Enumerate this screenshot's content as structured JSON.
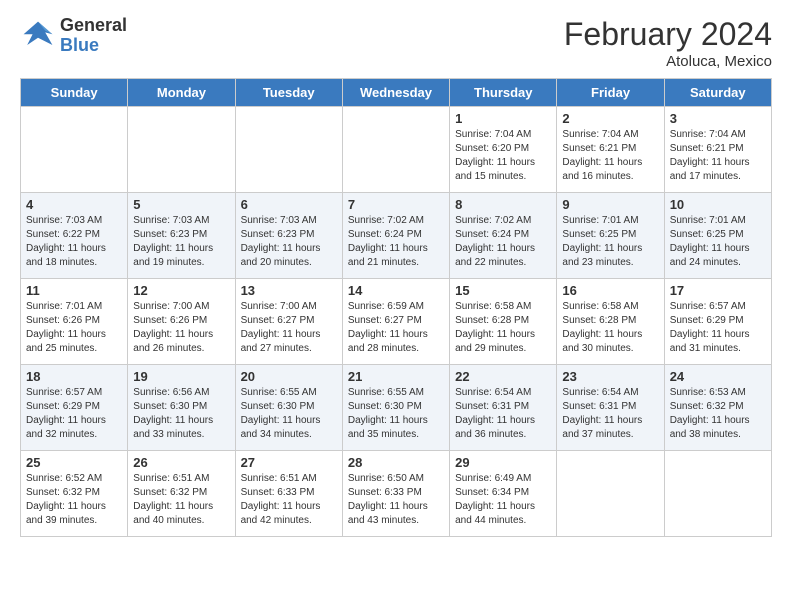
{
  "header": {
    "logo_line1": "General",
    "logo_line2": "Blue",
    "main_title": "February 2024",
    "subtitle": "Atoluca, Mexico"
  },
  "weekdays": [
    "Sunday",
    "Monday",
    "Tuesday",
    "Wednesday",
    "Thursday",
    "Friday",
    "Saturday"
  ],
  "weeks": [
    [
      {
        "day": "",
        "info": ""
      },
      {
        "day": "",
        "info": ""
      },
      {
        "day": "",
        "info": ""
      },
      {
        "day": "",
        "info": ""
      },
      {
        "day": "1",
        "info": "Sunrise: 7:04 AM\nSunset: 6:20 PM\nDaylight: 11 hours\nand 15 minutes."
      },
      {
        "day": "2",
        "info": "Sunrise: 7:04 AM\nSunset: 6:21 PM\nDaylight: 11 hours\nand 16 minutes."
      },
      {
        "day": "3",
        "info": "Sunrise: 7:04 AM\nSunset: 6:21 PM\nDaylight: 11 hours\nand 17 minutes."
      }
    ],
    [
      {
        "day": "4",
        "info": "Sunrise: 7:03 AM\nSunset: 6:22 PM\nDaylight: 11 hours\nand 18 minutes."
      },
      {
        "day": "5",
        "info": "Sunrise: 7:03 AM\nSunset: 6:23 PM\nDaylight: 11 hours\nand 19 minutes."
      },
      {
        "day": "6",
        "info": "Sunrise: 7:03 AM\nSunset: 6:23 PM\nDaylight: 11 hours\nand 20 minutes."
      },
      {
        "day": "7",
        "info": "Sunrise: 7:02 AM\nSunset: 6:24 PM\nDaylight: 11 hours\nand 21 minutes."
      },
      {
        "day": "8",
        "info": "Sunrise: 7:02 AM\nSunset: 6:24 PM\nDaylight: 11 hours\nand 22 minutes."
      },
      {
        "day": "9",
        "info": "Sunrise: 7:01 AM\nSunset: 6:25 PM\nDaylight: 11 hours\nand 23 minutes."
      },
      {
        "day": "10",
        "info": "Sunrise: 7:01 AM\nSunset: 6:25 PM\nDaylight: 11 hours\nand 24 minutes."
      }
    ],
    [
      {
        "day": "11",
        "info": "Sunrise: 7:01 AM\nSunset: 6:26 PM\nDaylight: 11 hours\nand 25 minutes."
      },
      {
        "day": "12",
        "info": "Sunrise: 7:00 AM\nSunset: 6:26 PM\nDaylight: 11 hours\nand 26 minutes."
      },
      {
        "day": "13",
        "info": "Sunrise: 7:00 AM\nSunset: 6:27 PM\nDaylight: 11 hours\nand 27 minutes."
      },
      {
        "day": "14",
        "info": "Sunrise: 6:59 AM\nSunset: 6:27 PM\nDaylight: 11 hours\nand 28 minutes."
      },
      {
        "day": "15",
        "info": "Sunrise: 6:58 AM\nSunset: 6:28 PM\nDaylight: 11 hours\nand 29 minutes."
      },
      {
        "day": "16",
        "info": "Sunrise: 6:58 AM\nSunset: 6:28 PM\nDaylight: 11 hours\nand 30 minutes."
      },
      {
        "day": "17",
        "info": "Sunrise: 6:57 AM\nSunset: 6:29 PM\nDaylight: 11 hours\nand 31 minutes."
      }
    ],
    [
      {
        "day": "18",
        "info": "Sunrise: 6:57 AM\nSunset: 6:29 PM\nDaylight: 11 hours\nand 32 minutes."
      },
      {
        "day": "19",
        "info": "Sunrise: 6:56 AM\nSunset: 6:30 PM\nDaylight: 11 hours\nand 33 minutes."
      },
      {
        "day": "20",
        "info": "Sunrise: 6:55 AM\nSunset: 6:30 PM\nDaylight: 11 hours\nand 34 minutes."
      },
      {
        "day": "21",
        "info": "Sunrise: 6:55 AM\nSunset: 6:30 PM\nDaylight: 11 hours\nand 35 minutes."
      },
      {
        "day": "22",
        "info": "Sunrise: 6:54 AM\nSunset: 6:31 PM\nDaylight: 11 hours\nand 36 minutes."
      },
      {
        "day": "23",
        "info": "Sunrise: 6:54 AM\nSunset: 6:31 PM\nDaylight: 11 hours\nand 37 minutes."
      },
      {
        "day": "24",
        "info": "Sunrise: 6:53 AM\nSunset: 6:32 PM\nDaylight: 11 hours\nand 38 minutes."
      }
    ],
    [
      {
        "day": "25",
        "info": "Sunrise: 6:52 AM\nSunset: 6:32 PM\nDaylight: 11 hours\nand 39 minutes."
      },
      {
        "day": "26",
        "info": "Sunrise: 6:51 AM\nSunset: 6:32 PM\nDaylight: 11 hours\nand 40 minutes."
      },
      {
        "day": "27",
        "info": "Sunrise: 6:51 AM\nSunset: 6:33 PM\nDaylight: 11 hours\nand 42 minutes."
      },
      {
        "day": "28",
        "info": "Sunrise: 6:50 AM\nSunset: 6:33 PM\nDaylight: 11 hours\nand 43 minutes."
      },
      {
        "day": "29",
        "info": "Sunrise: 6:49 AM\nSunset: 6:34 PM\nDaylight: 11 hours\nand 44 minutes."
      },
      {
        "day": "",
        "info": ""
      },
      {
        "day": "",
        "info": ""
      }
    ]
  ]
}
